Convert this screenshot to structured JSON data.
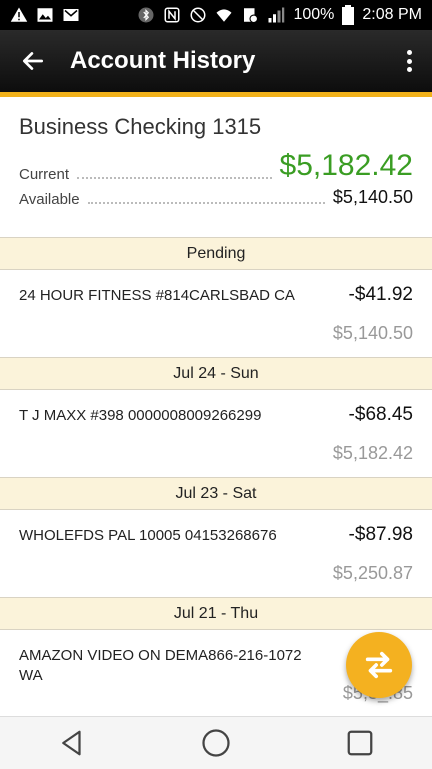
{
  "status_bar": {
    "battery": "100%",
    "time": "2:08 PM",
    "icons": [
      "warning-icon",
      "image-icon",
      "gmail-icon",
      "bluetooth-icon",
      "nfc-icon",
      "mute-icon",
      "wifi-icon",
      "data-off-icon",
      "signal-icon",
      "battery-icon"
    ]
  },
  "app_bar": {
    "title": "Account History",
    "back_icon": "arrow-back-icon",
    "menu_icon": "more-vert-icon"
  },
  "account": {
    "name": "Business Checking 1315",
    "current_label": "Current",
    "current_balance": "$5,182.42",
    "available_label": "Available",
    "available_balance": "$5,140.50",
    "current_color": "#3a9d23"
  },
  "sections": [
    {
      "header": "Pending",
      "transactions": [
        {
          "description": "24 HOUR FITNESS #814CARLSBAD CA",
          "amount": "-$41.92",
          "balance": "$5,140.50"
        }
      ]
    },
    {
      "header": "Jul 24 - Sun",
      "transactions": [
        {
          "description": "T J MAXX #398 0000008009266299",
          "amount": "-$68.45",
          "balance": "$5,182.42"
        }
      ]
    },
    {
      "header": "Jul 23 - Sat",
      "transactions": [
        {
          "description": "WHOLEFDS PAL 10005 04153268676",
          "amount": "-$87.98",
          "balance": "$5,250.87"
        }
      ]
    },
    {
      "header": "Jul 21 - Thu",
      "transactions": [
        {
          "description": "AMAZON VIDEO ON DEMA866-216-1072 WA",
          "amount": "",
          "balance": "$5,3_.85"
        }
      ]
    }
  ],
  "fab": {
    "icon": "transfer-icon",
    "color": "#f4b120"
  },
  "nav_bar": {
    "icons": [
      "back-triangle-icon",
      "home-circle-icon",
      "recents-square-icon"
    ]
  },
  "accent_color": "#f2b21b"
}
